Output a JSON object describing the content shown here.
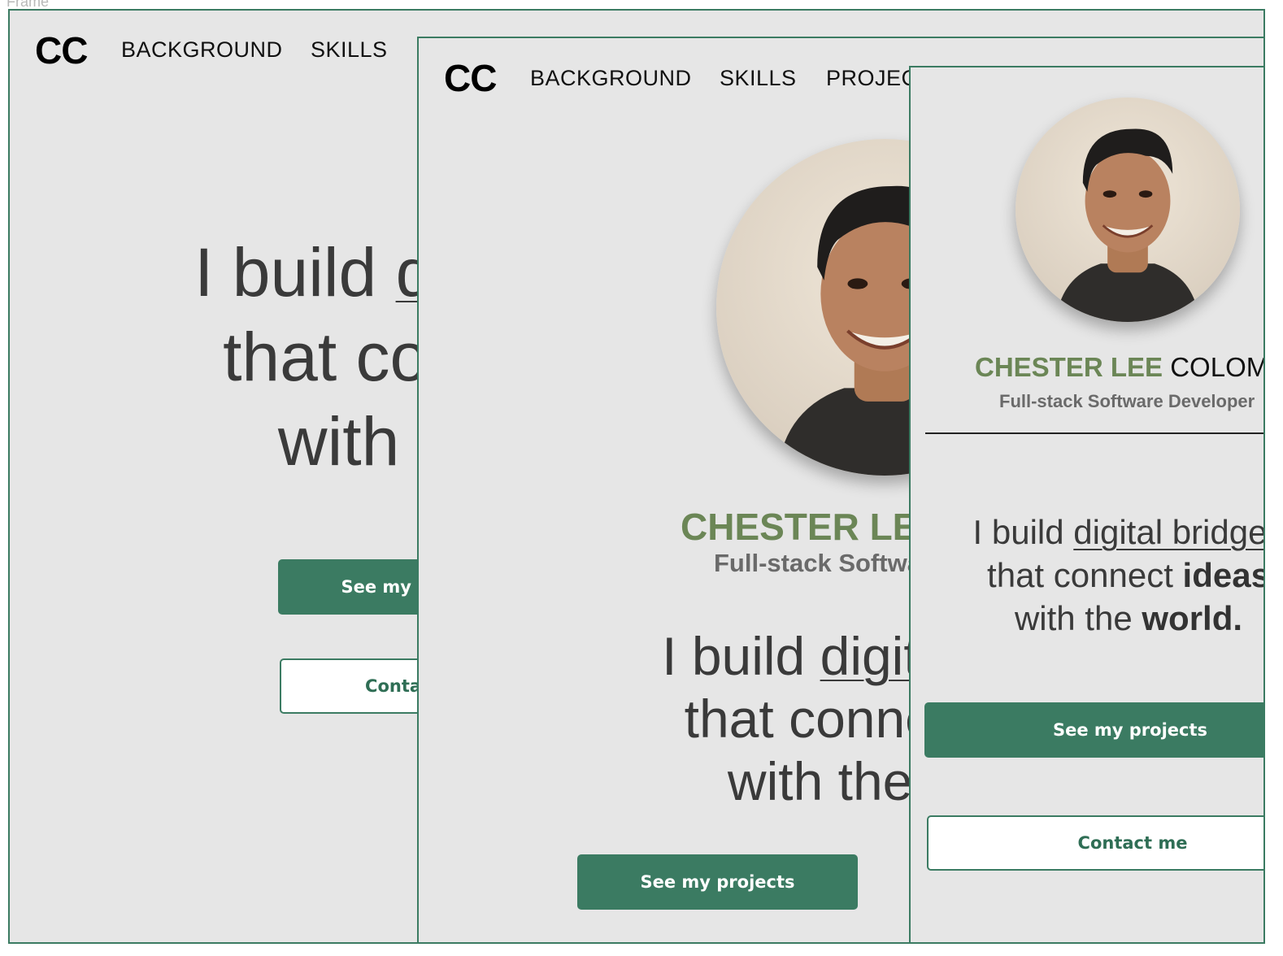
{
  "canvas": {
    "frame_label": "Frame"
  },
  "site": {
    "logo": "CC",
    "nav": {
      "background": "BACKGROUND",
      "skills": "SKILLS",
      "projects": "PROJECTS"
    },
    "name_first": "CHESTER LEE",
    "name_last": "COLOMA",
    "role": "Full-stack Software Developer",
    "tagline": {
      "part1": "I build ",
      "digital_bridges": "digital bridges",
      "part2": "that connect ",
      "ideas": "ideas",
      "part3": "with the ",
      "world": "world",
      "period": "."
    },
    "buttons": {
      "projects": "See my projects",
      "contact": "Contact me"
    },
    "avatar_alt": "Portrait of Chester Lee Coloma"
  },
  "colors": {
    "accent": "#3b7b62",
    "name_green": "#6b8656",
    "background": "#e6e6e6"
  }
}
